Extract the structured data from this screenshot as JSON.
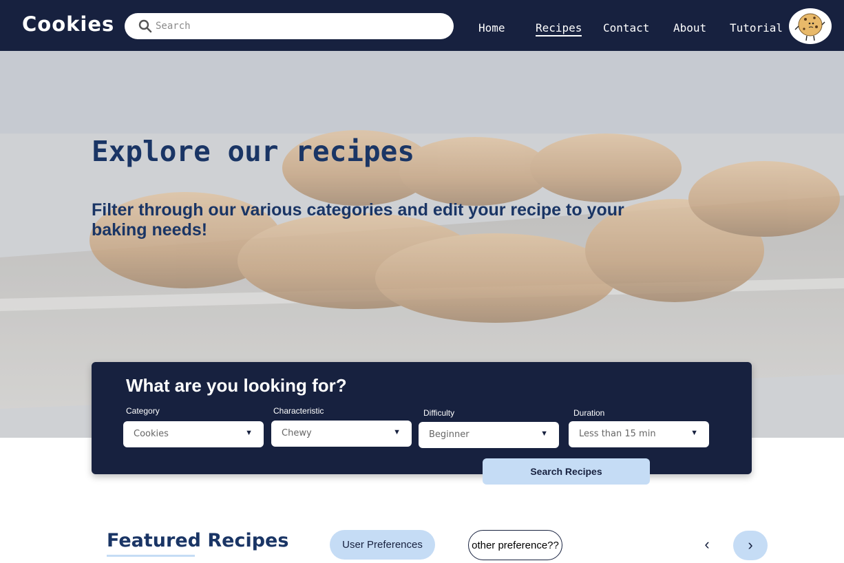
{
  "header": {
    "logo": "Cookies",
    "search": {
      "placeholder": "Search",
      "value": ""
    },
    "nav": [
      {
        "label": "Home"
      },
      {
        "label": "Recipes",
        "active": true
      },
      {
        "label": "Contact"
      },
      {
        "label": "About"
      },
      {
        "label": "Tutorial"
      }
    ],
    "avatar_icon": "cookie-mascot-icon"
  },
  "hero": {
    "title": "Explore our recipes",
    "subtitle": "Filter through our various categories and edit your recipe to your baking needs!"
  },
  "filters": {
    "title": "What are you looking for?",
    "fields": [
      {
        "label": "Category",
        "value": "Cookies"
      },
      {
        "label": "Characteristic",
        "value": "Chewy"
      },
      {
        "label": "Difficulty",
        "value": "Beginner"
      },
      {
        "label": "Duration",
        "value": "Less than 15 min"
      }
    ],
    "dropdown_icon": "▼",
    "search_button": "Search Recipes"
  },
  "featured": {
    "title": "Featured Recipes",
    "pref_primary": "User Preferences",
    "pref_secondary": "other preference??",
    "prev_icon": "‹",
    "next_icon": "›"
  },
  "colors": {
    "navy": "#17213f",
    "title_blue": "#1a3565",
    "light_blue": "#c5dcf5"
  }
}
